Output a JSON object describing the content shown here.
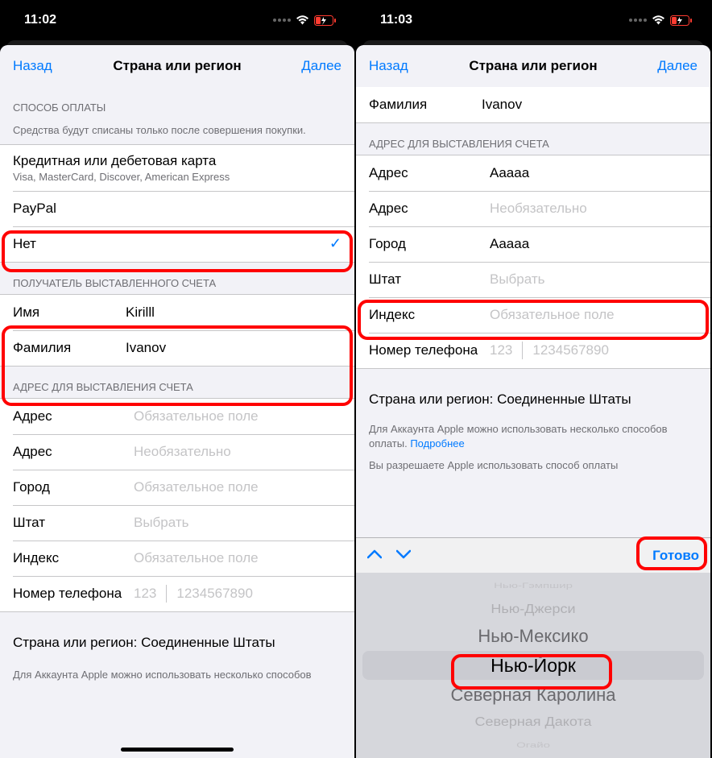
{
  "left": {
    "status_time": "11:02",
    "nav_back": "Назад",
    "nav_title": "Страна или регион",
    "nav_next": "Далее",
    "payment_header": "СПОСОБ ОПЛАТЫ",
    "payment_footer": "Средства будут списаны только после совершения покупки.",
    "payment_options": {
      "card_title": "Кредитная или дебетовая карта",
      "card_sub": "Visa, MasterCard, Discover, American Express",
      "paypal": "PayPal",
      "none": "Нет"
    },
    "recipient_header": "ПОЛУЧАТЕЛЬ ВЫСТАВЛЕННОГО СЧЕТА",
    "first_name_label": "Имя",
    "first_name_value": "Kirilll",
    "last_name_label": "Фамилия",
    "last_name_value": "Ivanov",
    "billing_header": "АДРЕС ДЛЯ ВЫСТАВЛЕНИЯ СЧЕТА",
    "address1_label": "Адрес",
    "address1_placeholder": "Обязательное поле",
    "address2_label": "Адрес",
    "address2_placeholder": "Необязательно",
    "city_label": "Город",
    "city_placeholder": "Обязательное поле",
    "state_label": "Штат",
    "state_placeholder": "Выбрать",
    "zip_label": "Индекс",
    "zip_placeholder": "Обязательное поле",
    "phone_label": "Номер телефона",
    "phone_prefix": "123",
    "phone_placeholder": "1234567890",
    "country_region": "Страна или регион: Соединенные Штаты",
    "bottom_text": "Для Аккаунта Apple можно использовать несколько способов"
  },
  "right": {
    "status_time": "11:03",
    "nav_back": "Назад",
    "nav_title": "Страна или регион",
    "nav_next": "Далее",
    "last_name_label": "Фамилия",
    "last_name_value": "Ivanov",
    "billing_header": "АДРЕС ДЛЯ ВЫСТАВЛЕНИЯ СЧЕТА",
    "address1_label": "Адрес",
    "address1_value": "Aaaaa",
    "address2_label": "Адрес",
    "address2_placeholder": "Необязательно",
    "city_label": "Город",
    "city_value": "Aaaaa",
    "state_label": "Штат",
    "state_placeholder": "Выбрать",
    "zip_label": "Индекс",
    "zip_placeholder": "Обязательное поле",
    "phone_label": "Номер телефона",
    "phone_prefix": "123",
    "phone_placeholder": "1234567890",
    "country_region": "Страна или регион: Соединенные Штаты",
    "info_text_1": "Для Аккаунта Apple можно использовать несколько способов оплаты. ",
    "info_link": "Подробнее",
    "info_text_2": "Вы разрешаете Apple использовать способ оплаты",
    "kb_done": "Готово",
    "picker_items": [
      "Нью-Гэмпшир",
      "Нью-Джерси",
      "Нью-Мексико",
      "Нью-Йорк",
      "Северная Каролина",
      "Северная Дакота",
      "Огайо"
    ]
  }
}
